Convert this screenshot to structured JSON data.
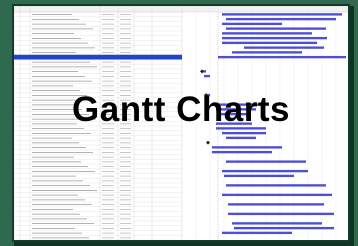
{
  "slide": {
    "title": "Gantt Charts",
    "background_color": "#2f6a4f",
    "card_color": "#ffffff"
  },
  "gantt": {
    "bar_color": "#4f4fd6",
    "highlight_row_color": "#2244cc",
    "row_count": 48
  }
}
